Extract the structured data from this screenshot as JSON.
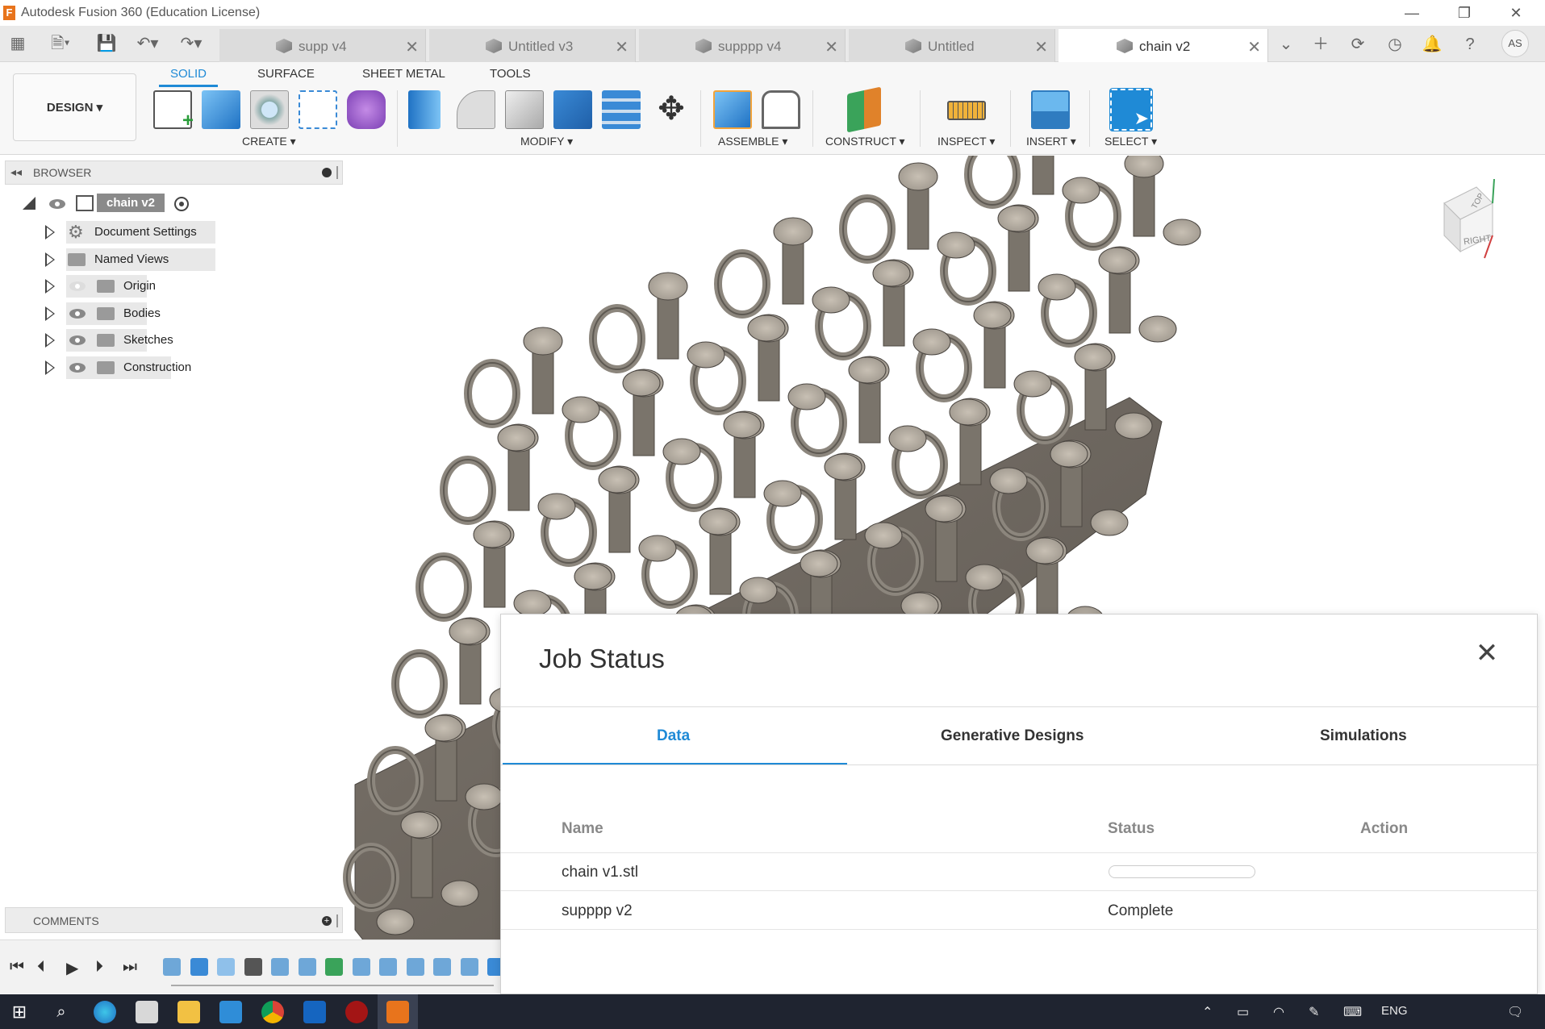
{
  "app": {
    "title": "Autodesk Fusion 360 (Education License)",
    "logo_letter": "F"
  },
  "window_controls": {
    "minimize": "—",
    "restore": "❐",
    "close": "✕"
  },
  "tabs": [
    {
      "label": "supp v4",
      "close": "✕"
    },
    {
      "label": "Untitled v3",
      "close": "✕"
    },
    {
      "label": "supppp v4",
      "close": "✕"
    },
    {
      "label": "Untitled",
      "close": "✕"
    },
    {
      "label": "chain v2",
      "close": "✕",
      "active": true
    }
  ],
  "user": {
    "initials": "AS"
  },
  "workspace": {
    "label": "DESIGN ▾"
  },
  "ribbon_tabs": [
    "SOLID",
    "SURFACE",
    "SHEET METAL",
    "TOOLS"
  ],
  "tool_groups": [
    "CREATE ▾",
    "MODIFY ▾",
    "ASSEMBLE ▾",
    "CONSTRUCT ▾",
    "INSPECT ▾",
    "INSERT ▾",
    "SELECT ▾"
  ],
  "browser": {
    "title": "BROWSER",
    "root": "chain v2",
    "items": [
      "Document Settings",
      "Named Views",
      "Origin",
      "Bodies",
      "Sketches",
      "Construction"
    ]
  },
  "comments": {
    "title": "COMMENTS"
  },
  "viewcube": {
    "top": "TOP",
    "right": "RIGHT"
  },
  "dialog": {
    "title": "Job Status",
    "close": "✕",
    "tabs": [
      "Data",
      "Generative Designs",
      "Simulations"
    ],
    "columns": [
      "Name",
      "Status",
      "Action"
    ],
    "rows": [
      {
        "name": "chain v1.stl",
        "status": "",
        "progress": 0
      },
      {
        "name": "supppp v2",
        "status": "Complete"
      }
    ]
  },
  "taskbar": {
    "lang": "ENG"
  },
  "colors": {
    "accent": "#1f8ad6",
    "brand": "#e8741c",
    "taskbar": "#1f2430"
  }
}
